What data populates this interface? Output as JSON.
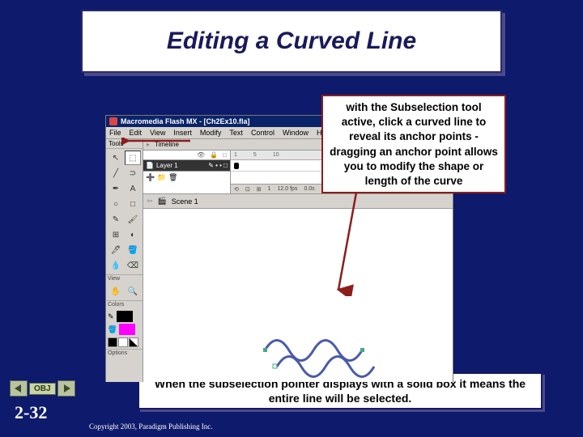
{
  "title": "Editing a Curved Line",
  "callout_top": "with the Subselection tool active, click a curved line to reveal its anchor points -dragging an anchor point allows you to modify the shape or length of the curve",
  "callout_bottom": "When the subselection pointer displays with a solid box it means the entire line will be selected.",
  "app": {
    "titlebar": "Macromedia Flash MX - [Ch2Ex10.fla]",
    "menus": [
      "File",
      "Edit",
      "View",
      "Insert",
      "Modify",
      "Text",
      "Control",
      "Window",
      "Help"
    ],
    "tools_label": "Tools",
    "view_label": "View",
    "colors_label": "Colors",
    "options_label": "Options",
    "timeline_label": "Timeline",
    "layer_name": "Layer 1",
    "scene_label": "Scene 1",
    "ruler_marks": [
      "1",
      "5",
      "10"
    ],
    "status": [
      "1",
      "12.0 fps",
      "0.0s"
    ]
  },
  "nav": {
    "obj_label": "OBJ"
  },
  "slide_number": "2-32",
  "copyright": "Copyright 2003, Paradigm Publishing Inc."
}
